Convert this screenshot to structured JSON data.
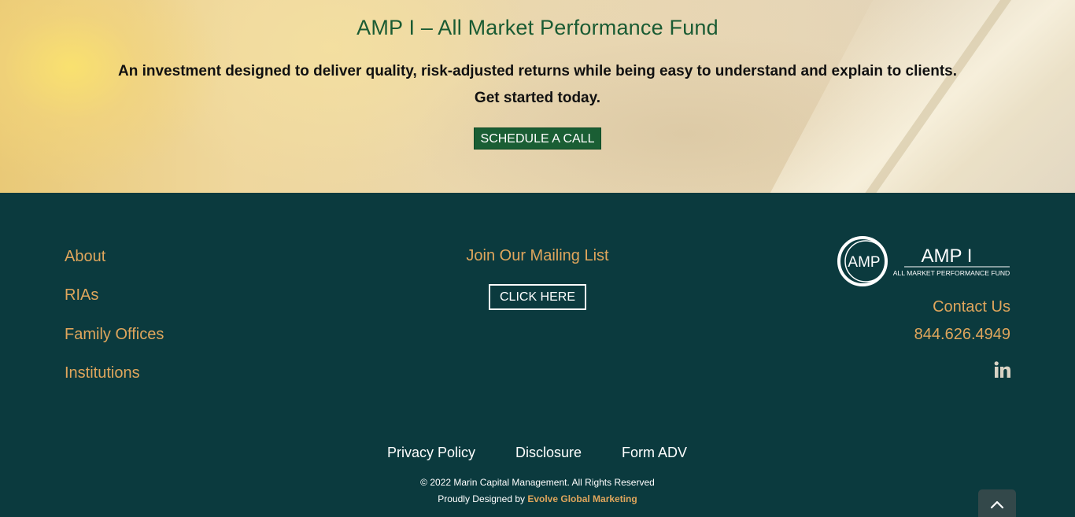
{
  "hero": {
    "title": "AMP I – All Market Performance Fund",
    "subtitle_line1": "An investment designed to deliver quality, risk-adjusted returns while being easy to understand and explain to clients.",
    "subtitle_line2": "Get started today.",
    "cta_label": "SCHEDULE A CALL"
  },
  "footer": {
    "nav": [
      "About",
      "RIAs",
      "Family Offices",
      "Institutions"
    ],
    "mailing_title": "Join Our Mailing List",
    "mailing_button": "CLICK HERE",
    "logo": {
      "badge_text": "AMP",
      "name": "AMP I",
      "tagline": "ALL MARKET PERFORMANCE FUND"
    },
    "contact_label": "Contact Us",
    "phone": "844.626.4949",
    "social_icon": "linkedin-icon",
    "legal_links": [
      "Privacy Policy",
      "Disclosure",
      "Form ADV"
    ],
    "copyright": "© 2022 Marin Capital Management. All Rights Reserved",
    "designed_prefix": "Proudly Designed by ",
    "designed_brand": "Evolve Global Marketing",
    "to_top_icon": "chevron-up-icon"
  },
  "colors": {
    "footer_bg": "#0b3a3e",
    "accent": "#e0a65c",
    "title_green": "#1a5b33",
    "button_green": "#1a5e34"
  }
}
